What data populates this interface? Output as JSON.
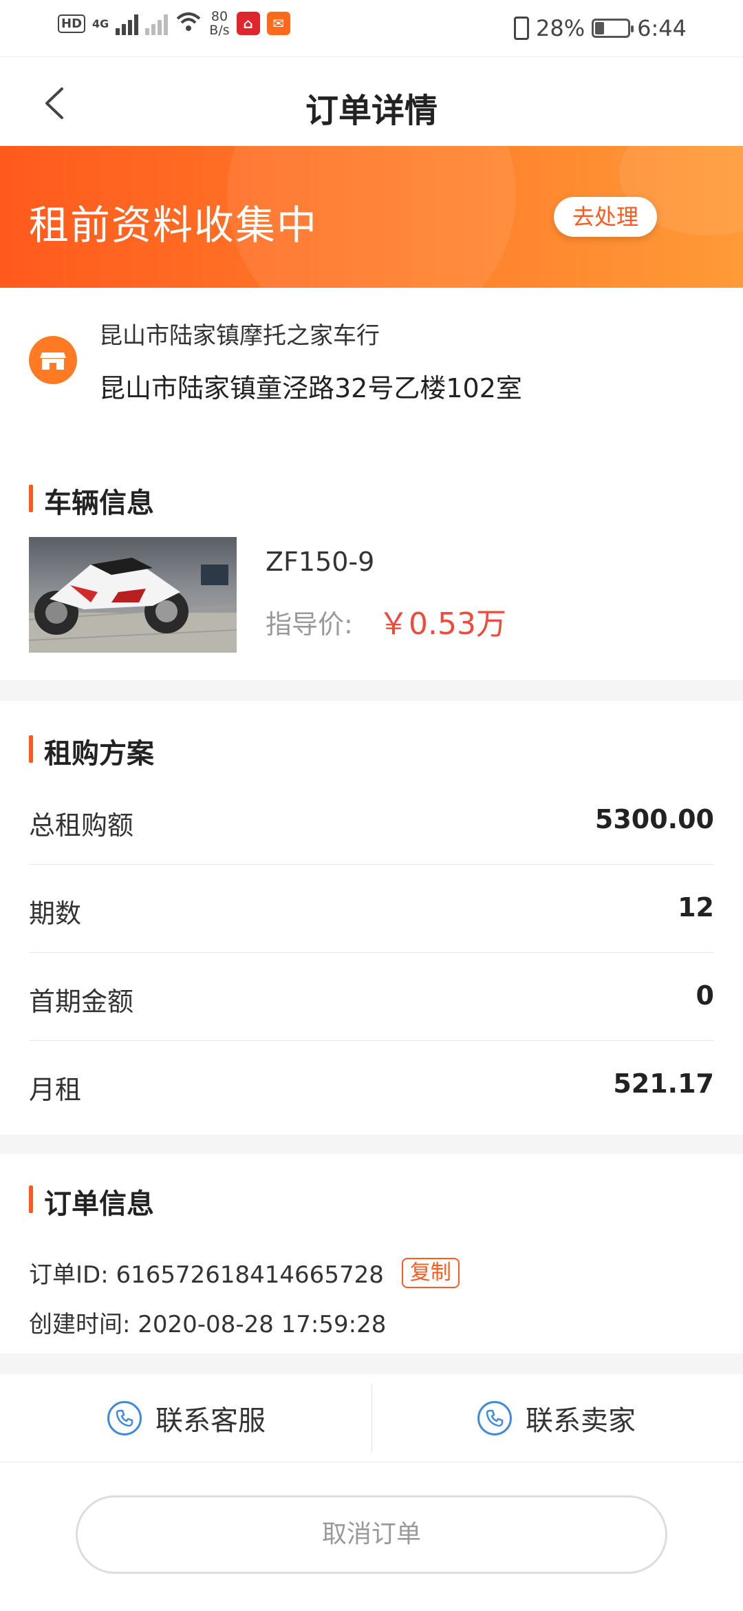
{
  "status_bar": {
    "hd": "HD",
    "net_type": "4G",
    "speed_value": "80",
    "speed_unit": "B/s",
    "battery": "28%",
    "battery_level": 0.28,
    "time": "6:44"
  },
  "nav": {
    "title": "订单详情"
  },
  "banner": {
    "status": "租前资料收集中",
    "action_label": "去处理"
  },
  "store": {
    "name": "昆山市陆家镇摩托之家车行",
    "address": "昆山市陆家镇童泾路32号乙楼102室"
  },
  "vehicle": {
    "section_title": "车辆信息",
    "model": "ZF150-9",
    "price_label": "指导价:",
    "price": "￥0.53万"
  },
  "plan": {
    "section_title": "租购方案",
    "rows": [
      {
        "label": "总租购额",
        "value": "5300.00"
      },
      {
        "label": "期数",
        "value": "12"
      },
      {
        "label": "首期金额",
        "value": "0"
      },
      {
        "label": "月租",
        "value": "521.17"
      }
    ]
  },
  "order_info": {
    "section_title": "订单信息",
    "id_line": "订单ID: 616572618414665728",
    "copy_label": "复制",
    "created_line": "创建时间: 2020-08-28 17:59:28"
  },
  "contact": {
    "service_label": "联系客服",
    "seller_label": "联系卖家"
  },
  "actions": {
    "cancel_label": "取消订单"
  },
  "colors": {
    "accent": "#ff5a1c",
    "price_red": "#f04a3a",
    "phone_blue": "#3d8ae0"
  }
}
